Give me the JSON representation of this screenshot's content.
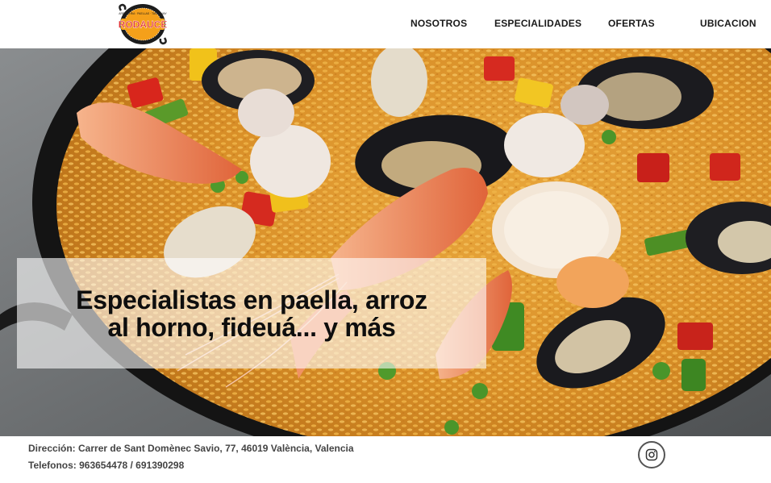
{
  "logo": {
    "text": "RODAUCE",
    "ring_text": "ARROCERIA · PAELLAS · TAKE AWAY",
    "brand_color": "#e0282b",
    "accent_color": "#f5a01a"
  },
  "nav": {
    "items": [
      {
        "label": "NOSOTROS"
      },
      {
        "label": "ESPECIALIDADES"
      },
      {
        "label": "OFERTAS"
      },
      {
        "label": "UBICACION"
      }
    ]
  },
  "hero": {
    "headline": "Especialistas en paella, arroz al horno, fideuá... y más",
    "image": "seafood-paella-photo"
  },
  "footer": {
    "address": "Dirección: Carrer de Sant Domènec Savio, 77, 46019 València, Valencia",
    "phones": "Telefonos: 963654478 / 691390298",
    "social_icon": "instagram-icon"
  }
}
